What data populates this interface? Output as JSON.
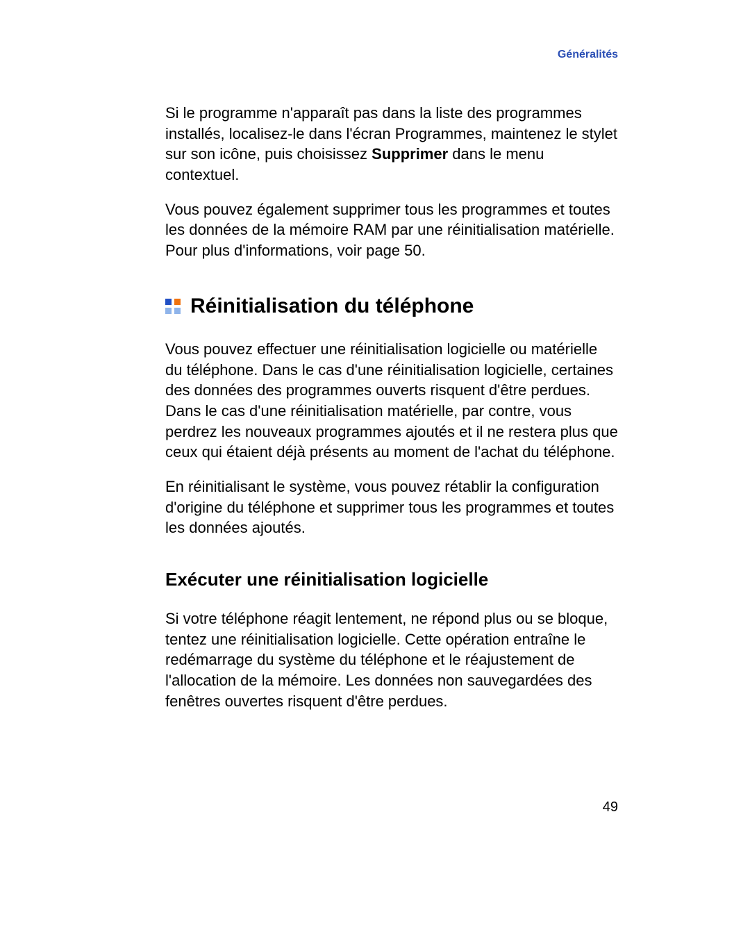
{
  "header": {
    "category": "Généralités"
  },
  "paragraphs": {
    "p1_pre": "Si le programme n'apparaît pas dans la liste des programmes installés, localisez-le dans l'écran Programmes, maintenez le stylet sur son icône, puis choisissez ",
    "p1_bold": "Supprimer",
    "p1_post": " dans le menu contextuel.",
    "p2": "Vous pouvez également supprimer tous les programmes et toutes les données de la mémoire RAM par une réinitialisation matérielle. Pour plus d'informations, voir page 50.",
    "p3": "Vous pouvez effectuer une réinitialisation logicielle ou matérielle du téléphone. Dans le cas d'une réinitialisation logicielle, certaines des données des programmes ouverts risquent d'être perdues. Dans le cas d'une réinitialisation matérielle, par contre, vous perdrez les nouveaux programmes ajoutés et il ne restera plus que ceux qui étaient déjà présents au moment de l'achat du téléphone.",
    "p4": "En réinitialisant le système, vous pouvez rétablir la configuration d'origine du téléphone et supprimer tous les programmes et toutes les données ajoutés.",
    "p5": "Si votre téléphone réagit lentement, ne répond plus ou se bloque, tentez une réinitialisation logicielle. Cette opération entraîne le redémarrage du système du téléphone et le réajustement de l'allocation de la mémoire. Les données non sauvegardées des fenêtres ouvertes risquent d'être perdues."
  },
  "headings": {
    "h1": "Réinitialisation du téléphone",
    "h2": "Exécuter une réinitialisation logicielle"
  },
  "page_number": "49"
}
